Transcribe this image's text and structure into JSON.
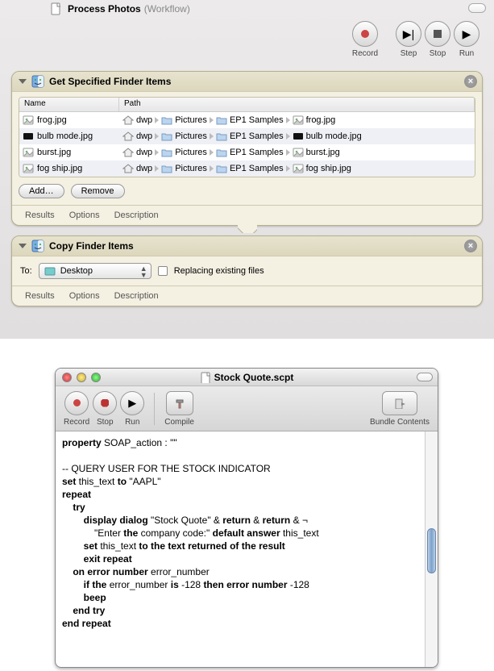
{
  "automator": {
    "title": "Process Photos",
    "subtitle": "(Workflow)",
    "toolbar": {
      "record": "Record",
      "step": "Step",
      "stop": "Stop",
      "run": "Run"
    },
    "action1": {
      "title": "Get Specified Finder Items",
      "columns": {
        "name": "Name",
        "path": "Path"
      },
      "rows": [
        {
          "name": "frog.jpg",
          "path": [
            "dwp",
            "Pictures",
            "EP1 Samples",
            "frog.jpg"
          ]
        },
        {
          "name": "bulb mode.jpg",
          "path": [
            "dwp",
            "Pictures",
            "EP1 Samples",
            "bulb mode.jpg"
          ]
        },
        {
          "name": "burst.jpg",
          "path": [
            "dwp",
            "Pictures",
            "EP1 Samples",
            "burst.jpg"
          ]
        },
        {
          "name": "fog ship.jpg",
          "path": [
            "dwp",
            "Pictures",
            "EP1 Samples",
            "fog ship.jpg"
          ]
        }
      ],
      "add": "Add…",
      "remove": "Remove",
      "tabs": {
        "results": "Results",
        "options": "Options",
        "description": "Description"
      }
    },
    "action2": {
      "title": "Copy Finder Items",
      "to_label": "To:",
      "destination": "Desktop",
      "replace_label": "Replacing existing files",
      "tabs": {
        "results": "Results",
        "options": "Options",
        "description": "Description"
      }
    }
  },
  "script_editor": {
    "title": "Stock Quote.scpt",
    "toolbar": {
      "record": "Record",
      "stop": "Stop",
      "run": "Run",
      "compile": "Compile",
      "bundle": "Bundle Contents"
    },
    "code_lines": [
      "property SOAP_action : \"\"",
      "",
      "-- QUERY USER FOR THE STOCK INDICATOR",
      "set this_text to \"AAPL\"",
      "repeat",
      "    try",
      "        display dialog \"Stock Quote\" & return & return & ¬",
      "            \"Enter the company code:\" default answer this_text",
      "        set this_text to the text returned of the result",
      "        exit repeat",
      "    on error number error_number",
      "        if the error_number is -128 then error number -128",
      "        beep",
      "    end try",
      "end repeat"
    ]
  }
}
